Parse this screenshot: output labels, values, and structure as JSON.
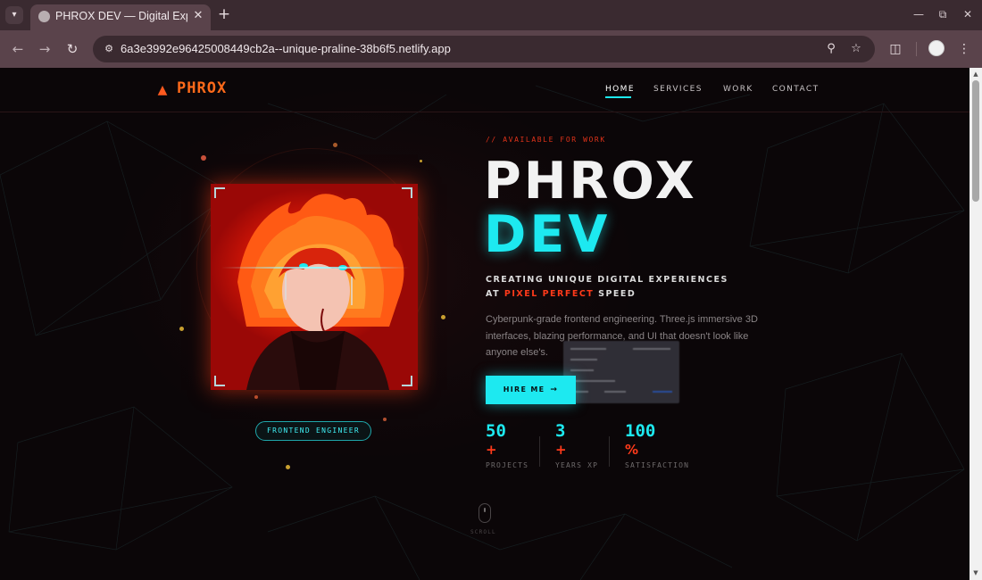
{
  "browser": {
    "tab_title": "PHROX DEV — Digital Exp",
    "url": "6a3e3992e96425008449cb2a--unique-praline-38b6f5.netlify.app"
  },
  "nav": {
    "logo": "PHROX",
    "links": [
      "HOME",
      "SERVICES",
      "WORK",
      "CONTACT"
    ],
    "active": "HOME"
  },
  "portrait": {
    "badge": "FRONTEND ENGINEER"
  },
  "hero": {
    "eyebrow": "// AVAILABLE FOR WORK",
    "title_line1": "PHROX",
    "title_line2": "DEV",
    "subtitle_line1": "CREATING UNIQUE DIGITAL EXPERIENCES",
    "subtitle_at": "AT",
    "subtitle_highlight": "PIXEL PERFECT",
    "subtitle_end": "SPEED",
    "description": "Cyberpunk-grade frontend engineering. Three.js immersive 3D interfaces, blazing performance, and UI that doesn't look like anyone else's.",
    "cta": "HIRE ME"
  },
  "stats": [
    {
      "value": "50",
      "suffix": "+",
      "label": "PROJECTS"
    },
    {
      "value": "3",
      "suffix": "+",
      "label": "YEARS XP"
    },
    {
      "value": "100",
      "suffix": "%",
      "label": "SATISFACTION"
    }
  ],
  "scroll_hint": "SCROLL",
  "colors": {
    "accent_cyan": "#1de9f0",
    "accent_red": "#ff3a1a",
    "logo_orange": "#ff6a1a",
    "background": "#0b0608"
  },
  "icons": {
    "logo": "rocket-icon",
    "cta": "arrow-right-icon"
  }
}
